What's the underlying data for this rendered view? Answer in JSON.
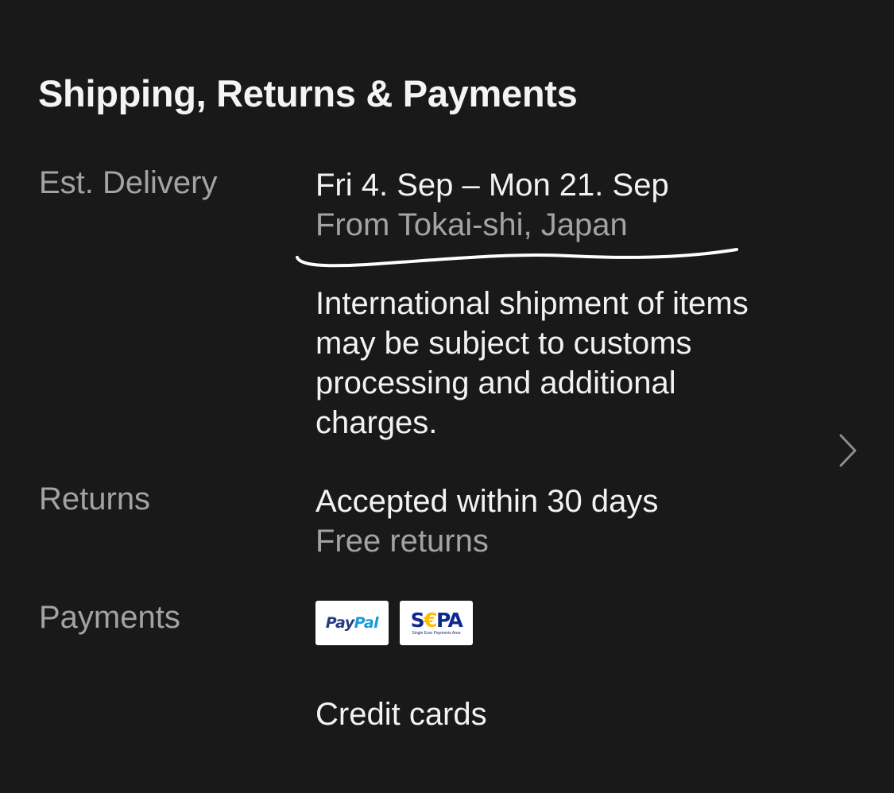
{
  "title": "Shipping, Returns & Payments",
  "delivery": {
    "label": "Est. Delivery",
    "dates": "Fri 4. Sep – Mon 21. Sep",
    "origin": "From Tokai-shi, Japan",
    "note_lines": [
      "International shipment of items",
      "may be subject to customs",
      "processing and additional",
      "charges."
    ]
  },
  "returns": {
    "label": "Returns",
    "policy": "Accepted within 30 days",
    "cost": "Free returns"
  },
  "payments": {
    "label": "Payments",
    "paypal_badge": {
      "part1": "Pay",
      "part2": "Pal"
    },
    "sepa_badge": {
      "s": "S",
      "euro": "€",
      "pa": "PA",
      "caption": "Single Euro Payments Area"
    },
    "extra": "Credit cards"
  },
  "colors": {
    "background": "#191919",
    "primary_text": "#f2f2f2",
    "secondary_text": "#a3a3a3",
    "annotation": "#ffffff"
  },
  "icons": {
    "chevron": "chevron-right-icon",
    "underline": "handwritten-underline-annotation"
  }
}
